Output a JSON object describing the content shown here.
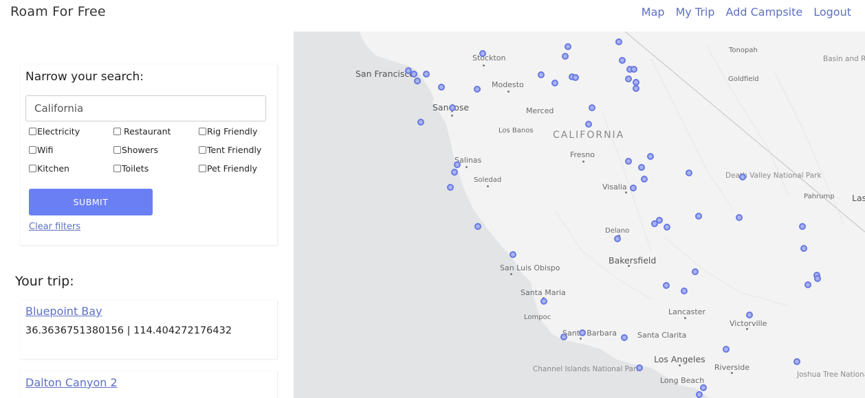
{
  "header": {
    "brand": "Roam For Free",
    "nav": [
      "Map",
      "My Trip",
      "Add Campsite",
      "Logout"
    ]
  },
  "filters": {
    "title": "Narrow your search:",
    "search_value": "California",
    "checkboxes": [
      "Electricity",
      "Restaurant",
      "Rig Friendly",
      "Wifi",
      "Showers",
      "Tent Friendly",
      "Kitchen",
      "Toilets",
      "Pet Friendly"
    ],
    "submit_label": "SUBMIT",
    "clear_label": "Clear filters"
  },
  "trip": {
    "title": "Your trip:",
    "items": [
      {
        "name": "Bluepoint Bay",
        "coords": "36.3636751380156 | 114.404272176432"
      },
      {
        "name": "Dalton Canyon 2"
      }
    ]
  },
  "map": {
    "state_label": "CALIFORNIA",
    "cities": [
      "San Francisco",
      "Stockton",
      "Modesto",
      "San Jose",
      "Merced",
      "Los Banos",
      "Fresno",
      "Salinas",
      "Soledad",
      "Visalia",
      "Delano",
      "Bakersfield",
      "San Luis Obispo",
      "Santa Maria",
      "Lompoc",
      "Santa Barbara",
      "Santa Clarita",
      "Lancaster",
      "Victorville",
      "Los Angeles",
      "Riverside",
      "Long Beach",
      "Tonopah",
      "Goldfield",
      "Pahrump",
      "Las"
    ],
    "parks": [
      "Death Valley National Park",
      "Channel Islands National Park",
      "Joshua Tree National Park",
      "Basin and Range National Monument"
    ],
    "colors": {
      "marker_fill": "#a9b3f3",
      "marker_stroke": "#6778e0",
      "ocean": "#e2e4e6",
      "land": "#f3f3f3",
      "link": "#5d6fc4",
      "button": "#6b7ff5"
    }
  }
}
